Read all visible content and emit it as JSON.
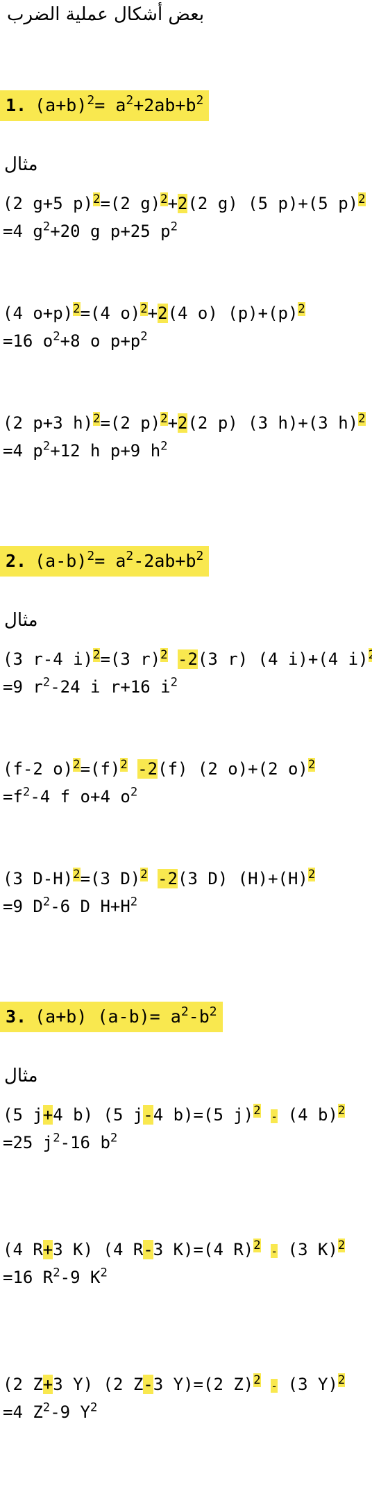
{
  "title": "بعض أشكال عملية الضرب",
  "example_label": "مثال",
  "sections": [
    {
      "number": "1.",
      "formula": [
        "(a+b)",
        "2",
        "=  a",
        "2",
        "+2ab+b",
        "2"
      ],
      "examples": [
        {
          "l1": [
            "(2 g+5 p)",
            "2",
            "=(2 g)",
            "2",
            "+",
            "2",
            "(2 g) (5 p)+(5 p)",
            "2"
          ],
          "l2": [
            "=4 g",
            "2",
            "+20 g p+25 p",
            "2"
          ]
        },
        {
          "l1": [
            "(4 o+p)",
            "2",
            "=(4 o)",
            "2",
            "+",
            "2",
            "(4 o) (p)+(p)",
            "2"
          ],
          "l2": [
            "=16 o",
            "2",
            "+8 o p+p",
            "2"
          ]
        },
        {
          "l1": [
            "(2 p+3 h)",
            "2",
            "=(2 p)",
            "2",
            "+",
            "2",
            "(2 p) (3 h)+(3 h)",
            "2"
          ],
          "l2": [
            "=4 p",
            "2",
            "+12 h p+9 h",
            "2"
          ]
        }
      ]
    },
    {
      "number": "2.",
      "formula": [
        "(a-b)",
        "2",
        "=  a",
        "2",
        "-2ab+b",
        "2"
      ],
      "examples": [
        {
          "l1": [
            "(3 r-4 i)",
            "2",
            "=(3 r)",
            "2",
            "-2",
            "(3 r) (4 i)+(4 i)",
            "2"
          ],
          "l2": [
            "=9 r",
            "2",
            "-24 i r+16 i",
            "2"
          ]
        },
        {
          "l1": [
            "(f-2 o)",
            "2",
            "=(f)",
            "2",
            "-2",
            "(f) (2 o)+(2 o)",
            "2"
          ],
          "l2": [
            "=f",
            "2",
            "-4 f o+4 o",
            "2"
          ]
        },
        {
          "l1": [
            "(3 D-H)",
            "2",
            "=(3 D)",
            "2",
            "-2",
            "(3 D) (H)+(H)",
            "2"
          ],
          "l2": [
            "=9 D",
            "2",
            "-6 D H+H",
            "2"
          ]
        }
      ]
    },
    {
      "number": "3.",
      "formula": [
        "(a+b) (a-b)=  a",
        "2",
        "-b",
        "2"
      ],
      "examples": [
        {
          "l1": [
            "(5 j",
            "+",
            "4 b) (5 j",
            "-",
            "4 b)=(5 j)",
            "2",
            "-",
            "(4 b)",
            "2"
          ],
          "l2": [
            "=25 j",
            "2",
            "-16 b",
            "2"
          ]
        },
        {
          "l1": [
            "(4 R",
            "+",
            "3 K) (4 R",
            "-",
            "3 K)=(4 R)",
            "2",
            "-",
            "(3 K)",
            "2"
          ],
          "l2": [
            "=16 R",
            "2",
            "-9 K",
            "2"
          ]
        },
        {
          "l1": [
            "(2 Z",
            "+",
            "3 Y) (2 Z",
            "-",
            "3 Y)=(2 Z)",
            "2",
            "-",
            "(3 Y)",
            "2"
          ],
          "l2": [
            "=4 Z",
            "2",
            "-9 Y",
            "2"
          ]
        }
      ]
    }
  ]
}
